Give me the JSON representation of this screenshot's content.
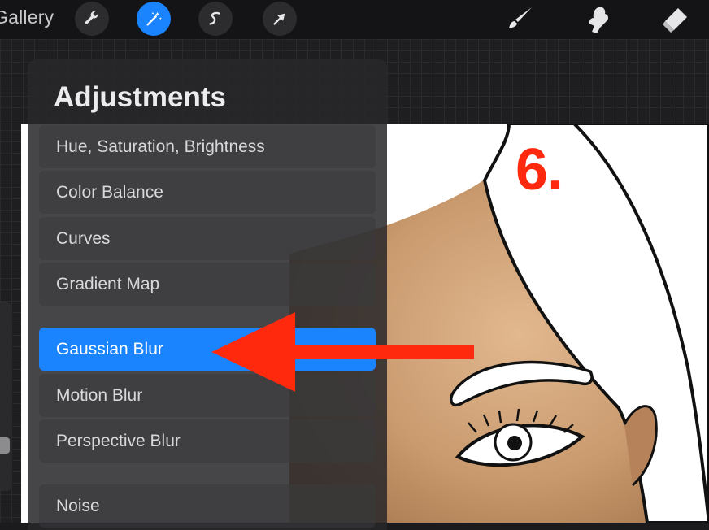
{
  "toolbar": {
    "gallery_label": "Gallery",
    "left_tools": [
      {
        "name": "actions",
        "icon": "wrench-icon"
      },
      {
        "name": "adjustments",
        "icon": "magic-wand-icon",
        "active": true
      },
      {
        "name": "selection",
        "icon": "selection-s-icon"
      },
      {
        "name": "transform",
        "icon": "arrow-cursor-icon"
      }
    ],
    "right_tools": [
      {
        "name": "brush",
        "icon": "brush-icon"
      },
      {
        "name": "smudge",
        "icon": "smudge-icon"
      },
      {
        "name": "eraser",
        "icon": "eraser-icon"
      }
    ],
    "accent_color": "#1a84ff"
  },
  "panel": {
    "title": "Adjustments",
    "items": [
      {
        "label": "Hue, Saturation, Brightness"
      },
      {
        "label": "Color Balance"
      },
      {
        "label": "Curves"
      },
      {
        "label": "Gradient Map"
      },
      {
        "label": "Gaussian Blur",
        "selected": true
      },
      {
        "label": "Motion Blur"
      },
      {
        "label": "Perspective Blur"
      },
      {
        "label": "Noise"
      }
    ]
  },
  "annotation": {
    "step_label": "6.",
    "arrow_color": "#ff2a0e"
  }
}
